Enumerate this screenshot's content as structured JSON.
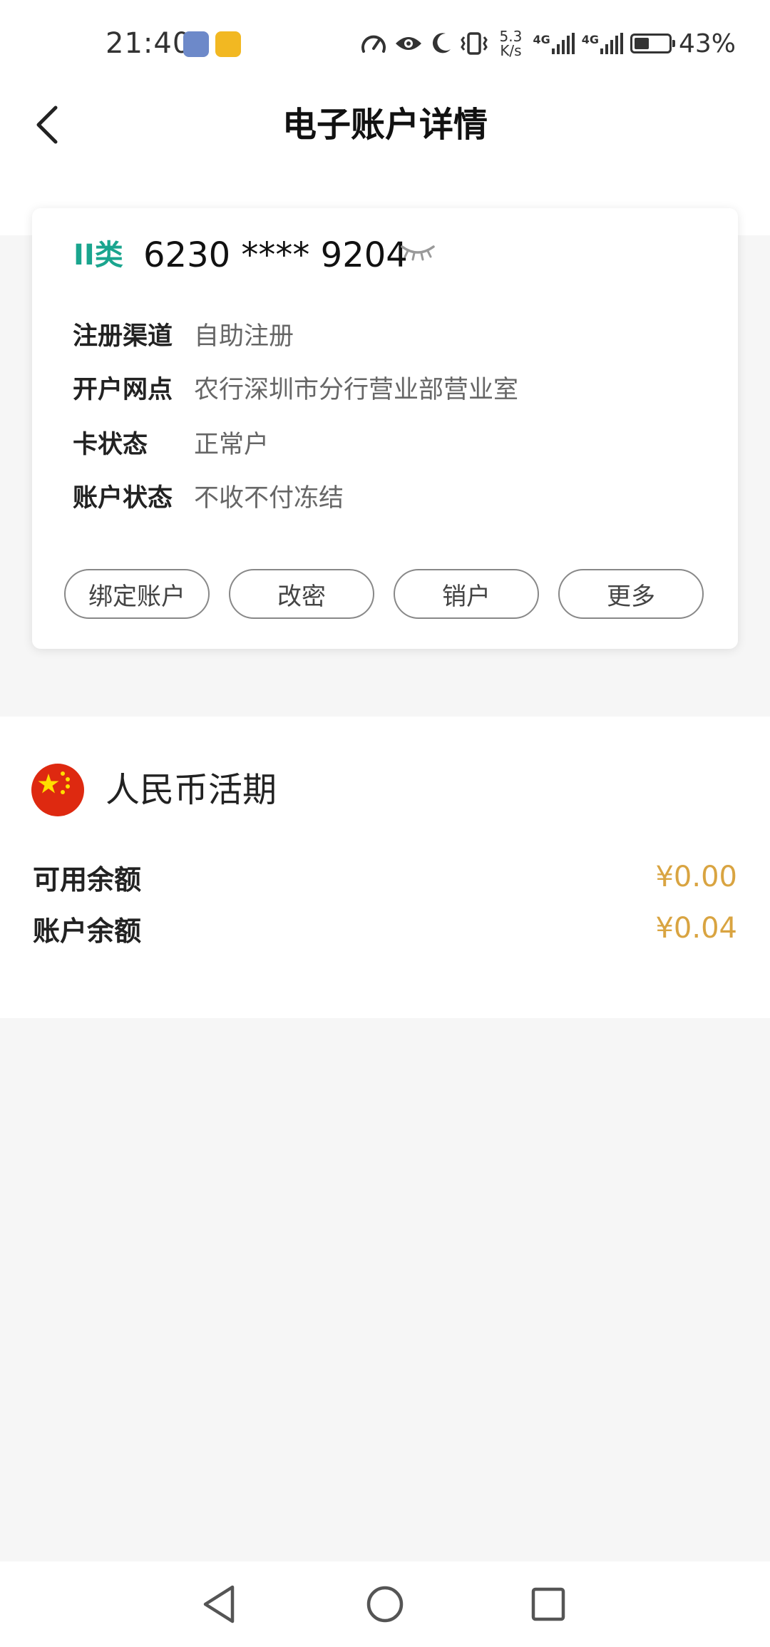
{
  "status_bar": {
    "time": "21:40",
    "net_speed_value": "5.3",
    "net_speed_unit": "K/s",
    "signal_1": "4G",
    "signal_2": "4G",
    "battery_level": 0.43,
    "battery_text": "43%"
  },
  "header": {
    "title": "电子账户详情"
  },
  "account_card": {
    "type_label": "II类",
    "card_number": "6230 **** 9204",
    "info": [
      {
        "label": "注册渠道",
        "value": "自助注册"
      },
      {
        "label": "开户网点",
        "value": "农行深圳市分行营业部营业室"
      },
      {
        "label": "卡状态",
        "value": "正常户"
      },
      {
        "label": "账户状态",
        "value": "不收不付冻结"
      }
    ],
    "actions": [
      {
        "label": "绑定账户"
      },
      {
        "label": "改密"
      },
      {
        "label": "销户"
      },
      {
        "label": "更多"
      }
    ]
  },
  "balance_section": {
    "currency_title": "人民币活期",
    "rows": [
      {
        "label": "可用余额",
        "value": "¥0.00"
      },
      {
        "label": "账户余额",
        "value": "¥0.04"
      }
    ]
  },
  "colors": {
    "accent_teal": "#1aa58e",
    "amount_gold": "#d9a441",
    "flag_red": "#de2910",
    "flag_yellow": "#ffde00"
  }
}
